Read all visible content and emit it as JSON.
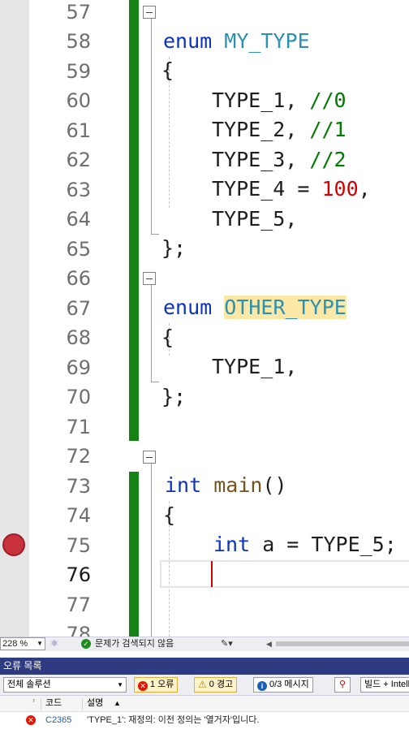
{
  "editor": {
    "line_numbers": [
      "57",
      "58",
      "59",
      "60",
      "61",
      "62",
      "63",
      "64",
      "65",
      "66",
      "67",
      "68",
      "69",
      "70",
      "71",
      "72",
      "73",
      "74",
      "75",
      "76",
      "77",
      "78"
    ],
    "current_line": "76",
    "breakpoint_line": "75",
    "code": {
      "l57": {
        "kw": "enum",
        "name": "MY_TYPE"
      },
      "l58": "{",
      "l59": {
        "text": "TYPE_1, ",
        "comment": "//0"
      },
      "l60": {
        "text": "TYPE_2, ",
        "comment": "//1"
      },
      "l61": {
        "text": "TYPE_3, ",
        "comment": "//2"
      },
      "l62": {
        "pre": "TYPE_4 = ",
        "num": "100",
        "post": ","
      },
      "l63": "TYPE_5,",
      "l64": "};",
      "l66": {
        "kw": "enum",
        "name": "OTHER_TYPE"
      },
      "l67": "{",
      "l68": "TYPE_1,",
      "l69": "};",
      "l72": {
        "kw": "int",
        "fn": "main",
        "post": "()"
      },
      "l73": "{",
      "l74": {
        "kw": "int",
        "post": " a = TYPE_5;"
      }
    }
  },
  "statusbar": {
    "zoom": "228 %",
    "message": "문제가 검색되지 않음"
  },
  "error_list": {
    "title": "오류 목록",
    "scope": "전체 솔루션",
    "errors_label": "1 오류",
    "warnings_label": "0 경고",
    "messages_label": "0/3 메시지",
    "build_filter": "빌드 + IntelliSense",
    "columns": {
      "code": "코드",
      "description": "설명"
    },
    "rows": [
      {
        "code": "C2365",
        "description": "'TYPE_1': 재정의: 이전 정의는 '열거자'입니다."
      }
    ]
  },
  "colors": {
    "changebar": "#148214",
    "keyword": "#0b31c4",
    "type": "#2b91af",
    "comment": "#007a00",
    "number": "#d40000",
    "panel_title": "#2e3b80",
    "breakpoint": "#c8323c"
  }
}
